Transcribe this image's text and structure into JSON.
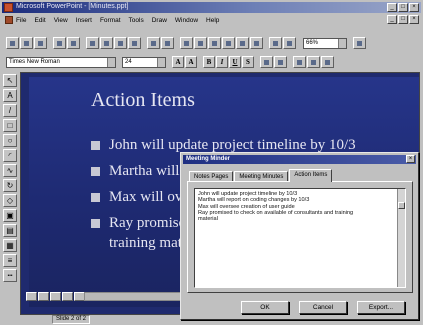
{
  "window": {
    "title": "Microsoft PowerPoint - [Minutes.ppt]",
    "controls": [
      "_",
      "□",
      "×"
    ]
  },
  "menubar": {
    "items": [
      "File",
      "Edit",
      "View",
      "Insert",
      "Format",
      "Tools",
      "Draw",
      "Window",
      "Help"
    ]
  },
  "toolbar": {
    "zoom": "66%"
  },
  "formatting": {
    "font": "Times New Roman",
    "size": "24",
    "buttons": [
      "A",
      "A",
      "B",
      "I",
      "U",
      "S"
    ]
  },
  "slide": {
    "title": "Action Items",
    "bullets": [
      "John will update project timeline by 10/3",
      "Martha will report on coding changes by 10/3",
      "Max will oversee creation of user guide",
      "Ray promised to check on available of consultants and training material"
    ]
  },
  "statusbar": {
    "slide_indicator": "Slide 2 of 2"
  },
  "dialog": {
    "title": "Meeting Minder",
    "close": "×",
    "tabs": [
      "Notes Pages",
      "Meeting Minutes",
      "Action Items"
    ],
    "active_tab": "Action Items",
    "notes_lines": [
      "John will update project timeline by 10/3",
      "Martha will report on coding changes by 10/3",
      "Max will oversee creation of user guide",
      "Ray promised to check on available of consultants and training",
      "material"
    ],
    "buttons": {
      "ok": "OK",
      "cancel": "Cancel",
      "export": "Export..."
    }
  }
}
